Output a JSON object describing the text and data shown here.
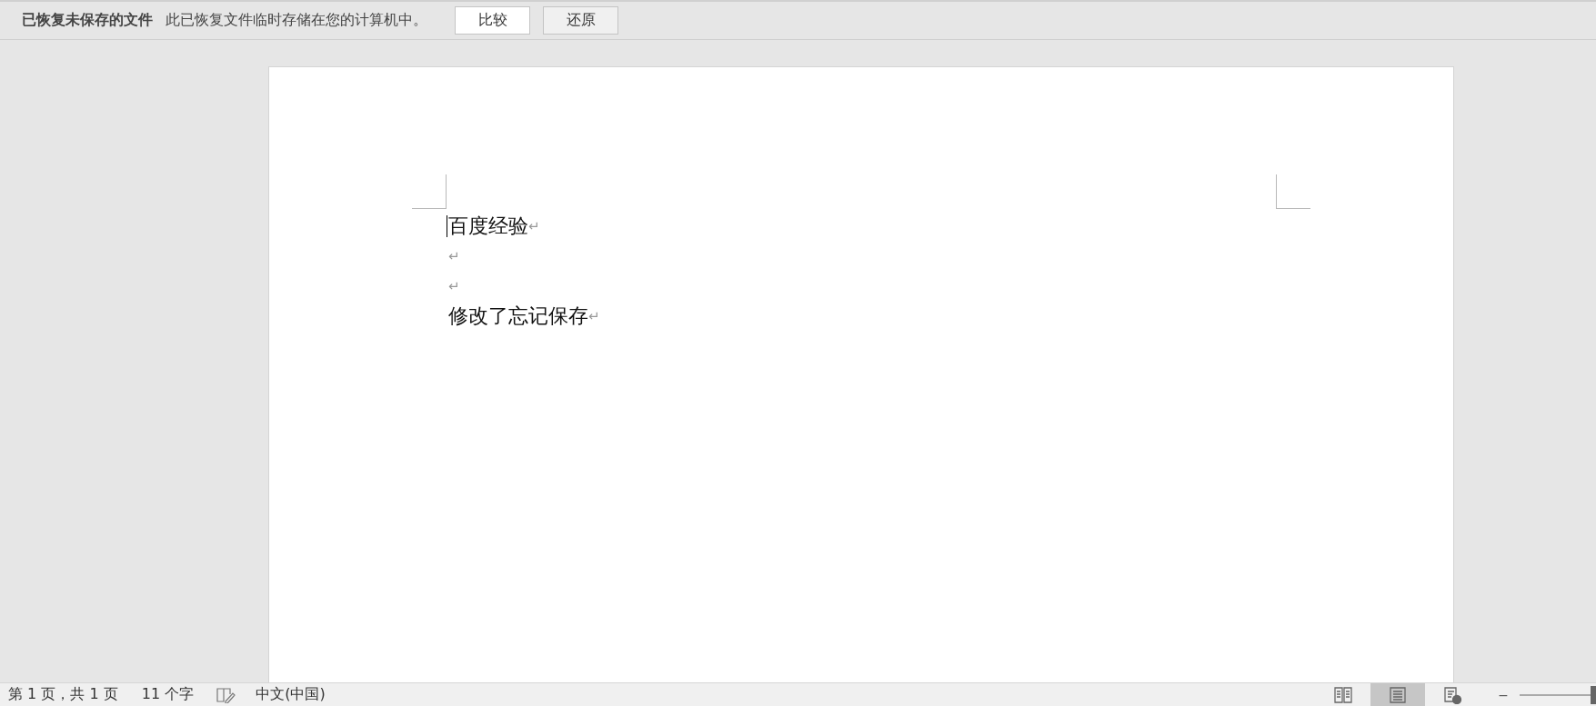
{
  "recovery_bar": {
    "title": "已恢复未保存的文件",
    "message": "此已恢复文件临时存储在您的计算机中。",
    "buttons": [
      "比较",
      "还原"
    ]
  },
  "document": {
    "paragraphs": [
      {
        "text": "百度经验",
        "mark": "↵",
        "cursor": true
      },
      {
        "mark": "↵",
        "cursor": false
      },
      {
        "mark": "↵",
        "cursor": false
      },
      {
        "text": "修改了忘记保存",
        "mark": "↵",
        "cursor": false
      }
    ]
  },
  "status_bar": {
    "page": "第 1 页，共 1 页",
    "word_count": "11 个字",
    "language": "中文(中国)",
    "views": [
      {
        "kind": "read",
        "selected": false
      },
      {
        "kind": "print",
        "selected": true
      },
      {
        "kind": "web",
        "selected": false
      }
    ],
    "zoom_out": "−",
    "zoom": {
      "level": 1
    }
  }
}
